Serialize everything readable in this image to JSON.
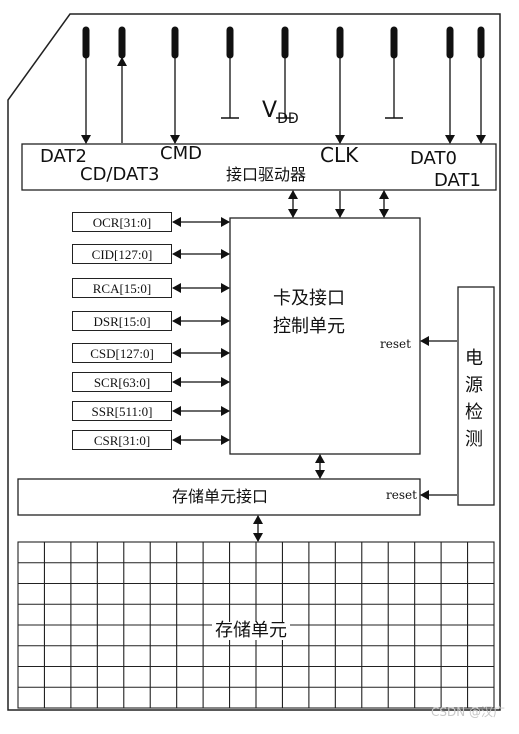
{
  "pins": {
    "dat2": "DAT2",
    "cd_dat3": "CD/DAT3",
    "cmd": "CMD",
    "vdd_main": "V",
    "vdd_sub": "DD",
    "clk": "CLK",
    "dat0": "DAT0",
    "dat1": "DAT1"
  },
  "interface_driver": "接口驱动器",
  "registers": [
    "OCR[31:0]",
    "CID[127:0]",
    "RCA[15:0]",
    "DSR[15:0]",
    "CSD[127:0]",
    "SCR[63:0]",
    "SSR[511:0]",
    "CSR[31:0]"
  ],
  "control_unit": {
    "line1": "卡及接口",
    "line2": "控制单元"
  },
  "reset_label_1": "reset",
  "reset_label_2": "reset",
  "power_detect": [
    "电",
    "源",
    "检",
    "测"
  ],
  "memory_interface": "存储单元接口",
  "memory_unit": "存储单元",
  "grid": {
    "cols": 18,
    "rows": 8
  },
  "watermark": "CSDN @汉广"
}
